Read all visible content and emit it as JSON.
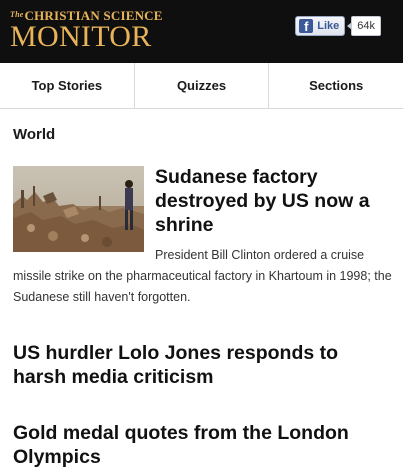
{
  "header": {
    "logo_the": "The",
    "logo_line1": "CHRISTIAN SCIENCE",
    "logo_line2": "MONITOR",
    "like_label": "Like",
    "like_count": "64k"
  },
  "nav": {
    "items": [
      {
        "label": "Top Stories"
      },
      {
        "label": "Quizzes"
      },
      {
        "label": "Sections"
      }
    ]
  },
  "section": {
    "title": "World"
  },
  "articles": [
    {
      "title": "Sudanese factory destroyed by US now a shrine",
      "summary": "President Bill Clinton ordered a cruise missile strike on the pharmaceutical factory in Khartoum in 1998; the Sudanese still haven't forgotten."
    },
    {
      "title": "US hurdler Lolo Jones responds to harsh media criticism"
    },
    {
      "title": "Gold medal quotes from the London Olympics"
    }
  ],
  "colors": {
    "header_bg": "#0f0f0f",
    "logo_gold": "#e8b45a",
    "facebook_blue": "#3b5998"
  }
}
